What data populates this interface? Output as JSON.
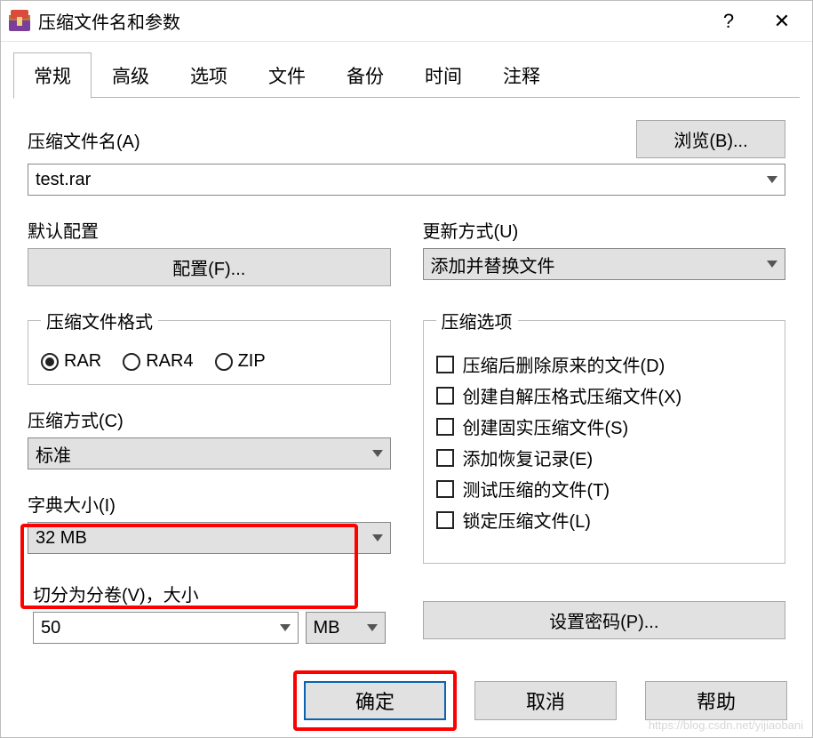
{
  "title": "压缩文件名和参数",
  "titlebar": {
    "help_glyph": "?",
    "close_glyph": "✕"
  },
  "tabs": [
    "常规",
    "高级",
    "选项",
    "文件",
    "备份",
    "时间",
    "注释"
  ],
  "active_tab": 0,
  "section": {
    "archive_name_label": "压缩文件名(A)",
    "archive_name_value": "test.rar",
    "browse_btn": "浏览(B)...",
    "profile_label": "默认配置",
    "profile_btn": "配置(F)...",
    "update_mode_label": "更新方式(U)",
    "update_mode_value": "添加并替换文件",
    "format_legend": "压缩文件格式",
    "formats": [
      "RAR",
      "RAR4",
      "ZIP"
    ],
    "format_selected": 0,
    "method_label": "压缩方式(C)",
    "method_value": "标准",
    "dict_label": "字典大小(I)",
    "dict_value": "32 MB",
    "split_label": "切分为分卷(V)，大小",
    "split_value": "50",
    "split_unit": "MB",
    "options_legend": "压缩选项",
    "options": [
      "压缩后删除原来的文件(D)",
      "创建自解压格式压缩文件(X)",
      "创建固实压缩文件(S)",
      "添加恢复记录(E)",
      "测试压缩的文件(T)",
      "锁定压缩文件(L)"
    ],
    "set_password_btn": "设置密码(P)..."
  },
  "footer": {
    "ok": "确定",
    "cancel": "取消",
    "help": "帮助"
  },
  "watermark": "https://blog.csdn.net/yijiaobani"
}
